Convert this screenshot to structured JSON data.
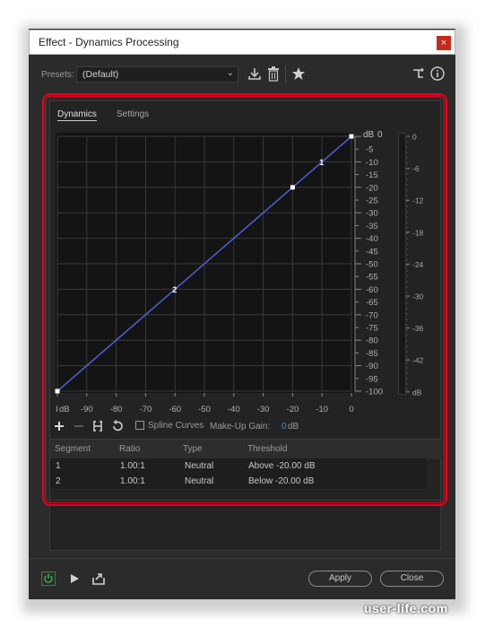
{
  "window": {
    "title": "Effect - Dynamics Processing",
    "close_glyph": "×"
  },
  "presets": {
    "label": "Presets:",
    "value": "(Default)"
  },
  "tabs": [
    {
      "label": "Dynamics",
      "active": true
    },
    {
      "label": "Settings",
      "active": false
    }
  ],
  "graph": {
    "unit_label": "dB",
    "y_ticks": [
      "0",
      "-5",
      "-10",
      "-15",
      "-20",
      "-25",
      "-30",
      "-35",
      "-40",
      "-45",
      "-50",
      "-55",
      "-60",
      "-65",
      "-70",
      "-75",
      "-80",
      "-85",
      "-90",
      "-95",
      "-100"
    ],
    "x_ticks": [
      "dB",
      "-90",
      "-80",
      "-70",
      "-60",
      "-50",
      "-40",
      "-30",
      "-20",
      "-10",
      "0"
    ],
    "x_lead": "I",
    "handles": [
      {
        "label": "1",
        "x": -10,
        "y": -10
      },
      {
        "label": "2",
        "x": -60,
        "y": -60
      }
    ],
    "line_color": "#4a5fd0",
    "chart_data": {
      "type": "line",
      "series": [
        {
          "x": [
            -100,
            -20,
            0
          ],
          "y": [
            -100,
            -20,
            0
          ]
        }
      ],
      "xlim": [
        -100,
        0
      ],
      "ylim": [
        -100,
        0
      ],
      "grid": true
    }
  },
  "meter": {
    "ticks": [
      "0",
      "-6",
      "-12",
      "-18",
      "-24",
      "-30",
      "-36",
      "-42",
      "dB"
    ]
  },
  "toolbar": {
    "spline_label": "Spline Curves",
    "makeup_label": "Make-Up Gain:",
    "makeup_value": "0",
    "makeup_unit": "dB"
  },
  "table": {
    "headers": [
      "Segment",
      "Ratio",
      "Type",
      "Threshold"
    ],
    "rows": [
      {
        "segment": "1",
        "ratio": "1.00:1",
        "type": "Neutral",
        "threshold": "Above -20.00 dB"
      },
      {
        "segment": "2",
        "ratio": "1.00:1",
        "type": "Neutral",
        "threshold": "Below -20.00 dB"
      }
    ]
  },
  "footer": {
    "apply_label": "Apply",
    "close_label": "Close"
  },
  "watermark": "user-life.com",
  "colors": {
    "highlight_red": "#e8001c",
    "accent_blue": "#3a8ee8",
    "power_green": "#2a8a3a"
  }
}
